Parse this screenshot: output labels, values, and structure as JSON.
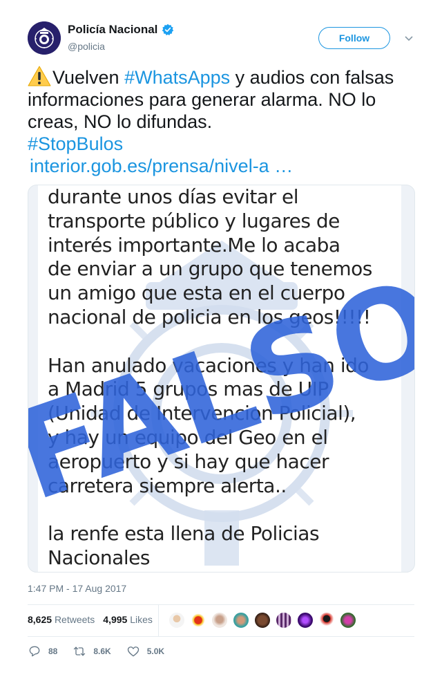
{
  "author": {
    "name": "Policía Nacional",
    "handle": "@policia",
    "verified_icon": "verified-badge-icon",
    "follow_label": "Follow"
  },
  "tweet": {
    "line1_prefix": "Vuelven ",
    "hashtag1": "#WhatsApps",
    "line1_rest": " y audios con falsas informaciones para generar alarma. NO lo creas, NO lo difundas.",
    "hashtag2": "#StopBulos",
    "link": "interior.gob.es/prensa/nivel-a …"
  },
  "media": {
    "message_text": "durante unos días evitar el\ntransporte público y lugares de\ninterés importante.Me lo acaba\nde enviar a un grupo que tenemos\nun amigo que esta en el cuerpo\nnacional de policia en los geos!!!!!\n\nHan anulado vacaciones y han ido\na Madrid 5 grupos mas de UIP\n(Unidad de Intervencion Policial),\ny hay un equipo del Geo en el\naeropuerto y si hay que hacer\ncarretera siempre alerta..\n\nla renfe esta llena de Policias\nNacionales",
    "stamp_text": "FALSO",
    "stamp_color": "#2f63d9"
  },
  "meta": {
    "timestamp": "1:47 PM - 17 Aug 2017",
    "retweets_count": "8,625",
    "retweets_label": "Retweets",
    "likes_count": "4,995",
    "likes_label": "Likes"
  },
  "actions": {
    "reply_count": "88",
    "retweet_count": "8.6K",
    "like_count": "5.0K"
  },
  "colors": {
    "accent": "#1b95e0",
    "secondary_text": "#657786",
    "verified": "#1da1f2"
  }
}
